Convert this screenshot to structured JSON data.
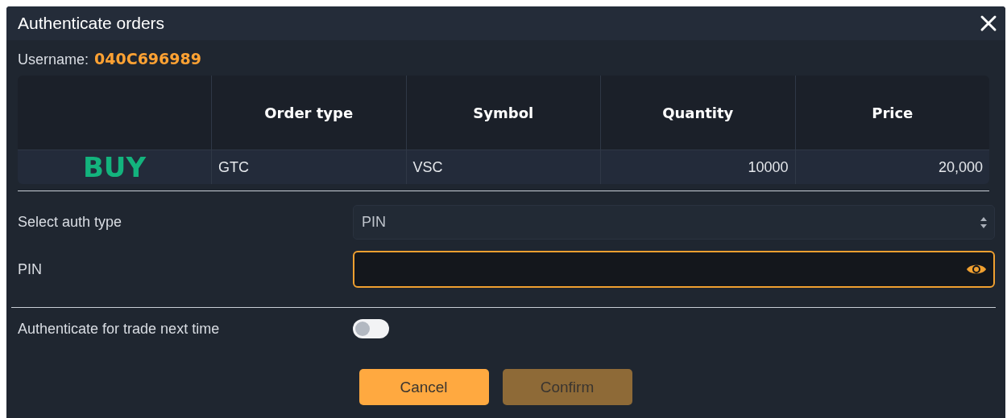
{
  "window": {
    "title": "Authenticate orders",
    "closable": true
  },
  "username": {
    "label": "Username:",
    "value": "040C696989"
  },
  "table": {
    "columns": [
      {
        "label": "Order type",
        "kind": "text"
      },
      {
        "label": "Symbol",
        "kind": "text"
      },
      {
        "label": "Quantity",
        "kind": "number"
      },
      {
        "label": "Price",
        "kind": "number"
      }
    ],
    "rows": [
      {
        "side": "BUY",
        "kind": "buy",
        "cells": [
          "GTC",
          "VSC",
          "10000",
          "20,000"
        ]
      }
    ]
  },
  "auth_type": {
    "label": "Select auth type",
    "value": "PIN"
  },
  "pin": {
    "label": "PIN",
    "focused": true
  },
  "remember": {
    "label": "Authenticate for trade next time",
    "on": false
  },
  "buttons": [
    {
      "label": "Cancel",
      "disabled": false
    },
    {
      "label": "Confirm",
      "disabled": true
    }
  ]
}
